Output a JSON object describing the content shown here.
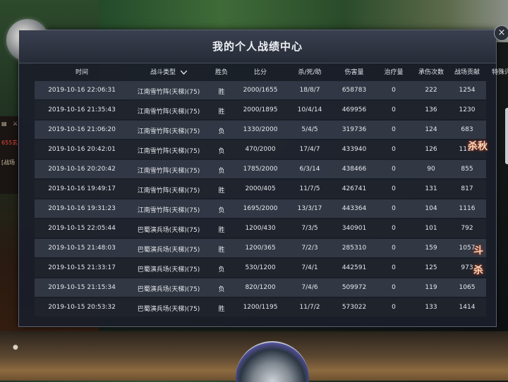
{
  "title": "我的个人战绩中心",
  "close_label": "×",
  "columns": {
    "time": "时间",
    "mode": "战斗类型",
    "result": "胜负",
    "score": "比分",
    "kda": "杀/死/助",
    "damage": "伤害量",
    "heal": "治疗量",
    "hurt": "承伤次数",
    "contrib": "战场贡献",
    "eval": "特殊评价"
  },
  "rows": [
    {
      "time": "2019-10-16 22:06:31",
      "mode": "江南雪竹阵(天梯)(75)",
      "result": "胜",
      "score": "2000/1655",
      "kda": "18/8/7",
      "damage": "658783",
      "heal": "0",
      "hurt": "222",
      "contrib": "1254"
    },
    {
      "time": "2019-10-16 21:35:43",
      "mode": "江南雪竹阵(天梯)(75)",
      "result": "胜",
      "score": "2000/1895",
      "kda": "10/4/14",
      "damage": "469956",
      "heal": "0",
      "hurt": "136",
      "contrib": "1230"
    },
    {
      "time": "2019-10-16 21:06:20",
      "mode": "江南雪竹阵(天梯)(75)",
      "result": "负",
      "score": "1330/2000",
      "kda": "5/4/5",
      "damage": "319736",
      "heal": "0",
      "hurt": "124",
      "contrib": "683"
    },
    {
      "time": "2019-10-16 20:42:01",
      "mode": "江南雪竹阵(天梯)(75)",
      "result": "负",
      "score": "470/2000",
      "kda": "17/4/7",
      "damage": "433940",
      "heal": "0",
      "hurt": "126",
      "contrib": "1117"
    },
    {
      "time": "2019-10-16 20:20:42",
      "mode": "江南雪竹阵(天梯)(75)",
      "result": "负",
      "score": "1785/2000",
      "kda": "6/3/14",
      "damage": "438466",
      "heal": "0",
      "hurt": "90",
      "contrib": "855"
    },
    {
      "time": "2019-10-16 19:49:17",
      "mode": "江南雪竹阵(天梯)(75)",
      "result": "胜",
      "score": "2000/405",
      "kda": "11/7/5",
      "damage": "426741",
      "heal": "0",
      "hurt": "131",
      "contrib": "817"
    },
    {
      "time": "2019-10-16 19:31:23",
      "mode": "江南雪竹阵(天梯)(75)",
      "result": "负",
      "score": "1695/2000",
      "kda": "13/3/17",
      "damage": "443364",
      "heal": "0",
      "hurt": "104",
      "contrib": "1116"
    },
    {
      "time": "2019-10-15 22:05:44",
      "mode": "巴蜀演兵场(天梯)(75)",
      "result": "胜",
      "score": "1200/430",
      "kda": "7/3/5",
      "damage": "340901",
      "heal": "0",
      "hurt": "101",
      "contrib": "792"
    },
    {
      "time": "2019-10-15 21:48:03",
      "mode": "巴蜀演兵场(天梯)(75)",
      "result": "胜",
      "score": "1200/365",
      "kda": "7/2/3",
      "damage": "285310",
      "heal": "0",
      "hurt": "159",
      "contrib": "1057"
    },
    {
      "time": "2019-10-15 21:33:17",
      "mode": "巴蜀演兵场(天梯)(75)",
      "result": "负",
      "score": "530/1200",
      "kda": "7/4/1",
      "damage": "442591",
      "heal": "0",
      "hurt": "125",
      "contrib": "973"
    },
    {
      "time": "2019-10-15 21:15:34",
      "mode": "巴蜀演兵场(天梯)(75)",
      "result": "负",
      "score": "820/1200",
      "kda": "7/4/6",
      "damage": "509972",
      "heal": "0",
      "hurt": "119",
      "contrib": "1065"
    },
    {
      "time": "2019-10-15 20:53:32",
      "mode": "巴蜀演兵场(天梯)(75)",
      "result": "胜",
      "score": "1200/1195",
      "kda": "11/7/2",
      "damage": "573022",
      "heal": "0",
      "hurt": "133",
      "contrib": "1414"
    }
  ],
  "awards": {
    "award_a": "杀秋",
    "award_b_top": "斗",
    "award_b_bottom": "杀"
  },
  "hud": {
    "value": "655",
    "label": "玄",
    "tag": "[战场"
  },
  "colors": {
    "panel": "#1a1e28",
    "row_odd": "#3a404e",
    "row_even": "#242832",
    "award_glow": "#c0402a"
  }
}
